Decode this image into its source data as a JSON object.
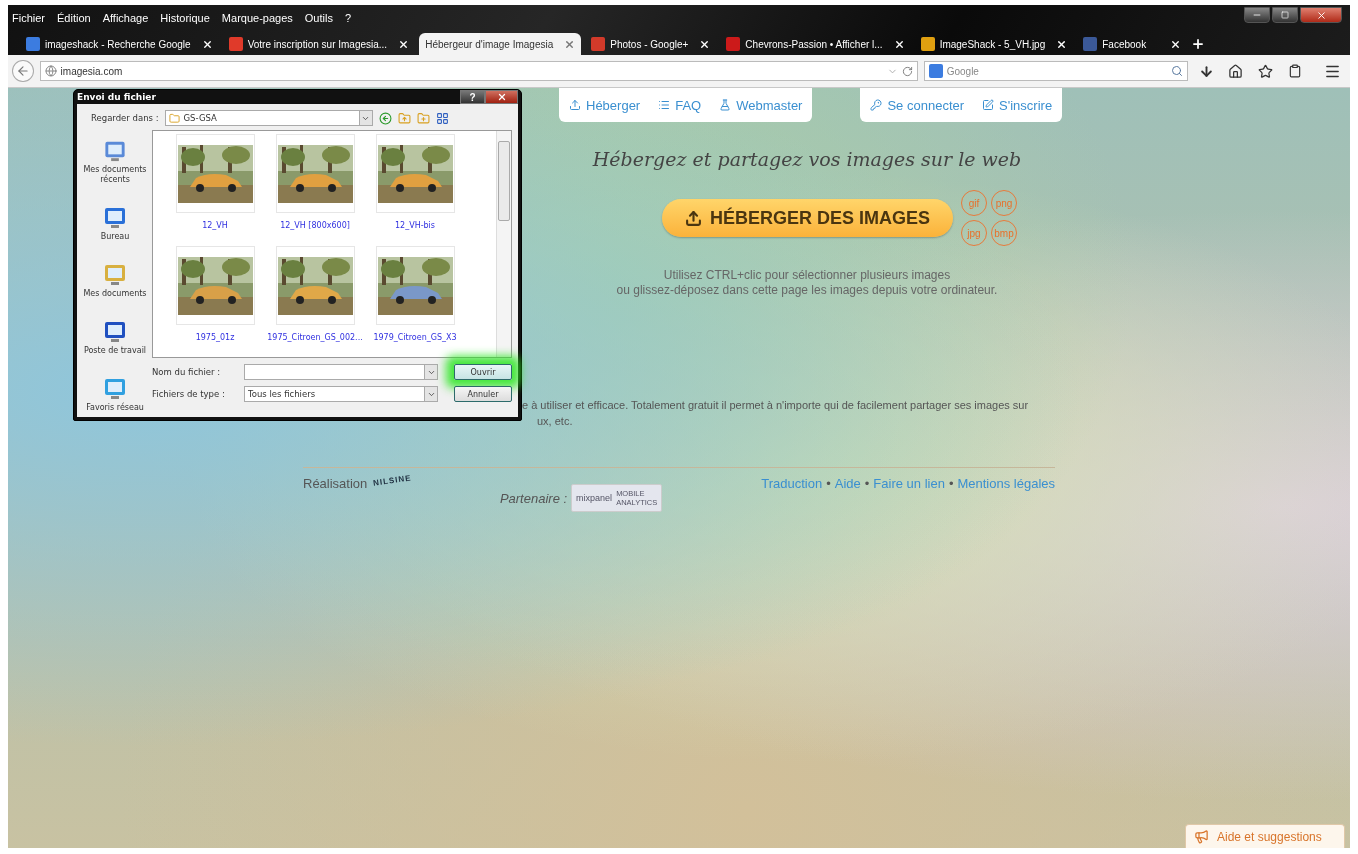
{
  "menu": [
    "Fichier",
    "Édition",
    "Affichage",
    "Historique",
    "Marque-pages",
    "Outils",
    "?"
  ],
  "tabs": [
    {
      "title": "imageshack - Recherche Google",
      "selected": false
    },
    {
      "title": "Votre inscription sur Imagesia...",
      "selected": false
    },
    {
      "title": "Hébergeur d'image Imagesia",
      "selected": true
    },
    {
      "title": "Photos - Google+",
      "selected": false
    },
    {
      "title": "Chevrons-Passion • Afficher l...",
      "selected": false
    },
    {
      "title": "ImageShack - 5_VH.jpg",
      "selected": false
    },
    {
      "title": "Facebook",
      "selected": false
    }
  ],
  "address_bar": {
    "url": "imagesia.com"
  },
  "search": {
    "placeholder": "Google"
  },
  "site_nav": {
    "left": [
      "Héberger",
      "FAQ",
      "Webmaster"
    ],
    "right": [
      "Se connecter",
      "S'inscrire"
    ]
  },
  "tagline": "Hébergez et partagez vos images sur le web",
  "upload_button": "HÉBERGER DES IMAGES",
  "formats": [
    "gif",
    "png",
    "jpg",
    "bmp"
  ],
  "help": [
    "Utilisez CTRL+clic pour sélectionner plusieurs images",
    "ou glissez-déposez dans cette page les images depuis votre ordinateur."
  ],
  "description": [
    "e à utiliser et efficace. Totalement gratuit il permet à n'importe qui de facilement partager ses images sur",
    "ux, etc."
  ],
  "footer": {
    "credit_label": "Réalisation",
    "credit_logo": "NILSINE",
    "partner_label": "Partenaire :",
    "partner_logo": "mixpanel",
    "partner_logo_sub": [
      "MOBILE",
      "ANALYTICS"
    ],
    "links": [
      {
        "label": "Traduction",
        "kind": "link"
      },
      {
        "label": "•",
        "kind": "separator"
      },
      {
        "label": "Aide",
        "kind": "link"
      },
      {
        "label": "•",
        "kind": "separator"
      },
      {
        "label": "Faire un lien",
        "kind": "link"
      },
      {
        "label": "•",
        "kind": "separator"
      },
      {
        "label": "Mentions légales",
        "kind": "link"
      }
    ]
  },
  "feedback_button": "Aide et suggestions",
  "dialog": {
    "title": "Envoi du fichier",
    "help_button": "?",
    "look_in_label": "Regarder dans :",
    "folder": "GS-GSA",
    "places": [
      "Mes documents récents",
      "Bureau",
      "Mes documents",
      "Poste de travail",
      "Favoris réseau"
    ],
    "files": [
      "12_VH",
      "12_VH [800x600]",
      "12_VH-bis",
      "1975_01z",
      "1975_Citroen_GS_002...",
      "1979_Citroen_GS_X3"
    ],
    "filename_label": "Nom du fichier :",
    "filetype_label": "Fichiers de type :",
    "filetype_value": "Tous les fichiers",
    "buttons": [
      {
        "label": "Ouvrir",
        "highlighted": true
      },
      {
        "label": "Annuler",
        "highlighted": false
      }
    ]
  }
}
